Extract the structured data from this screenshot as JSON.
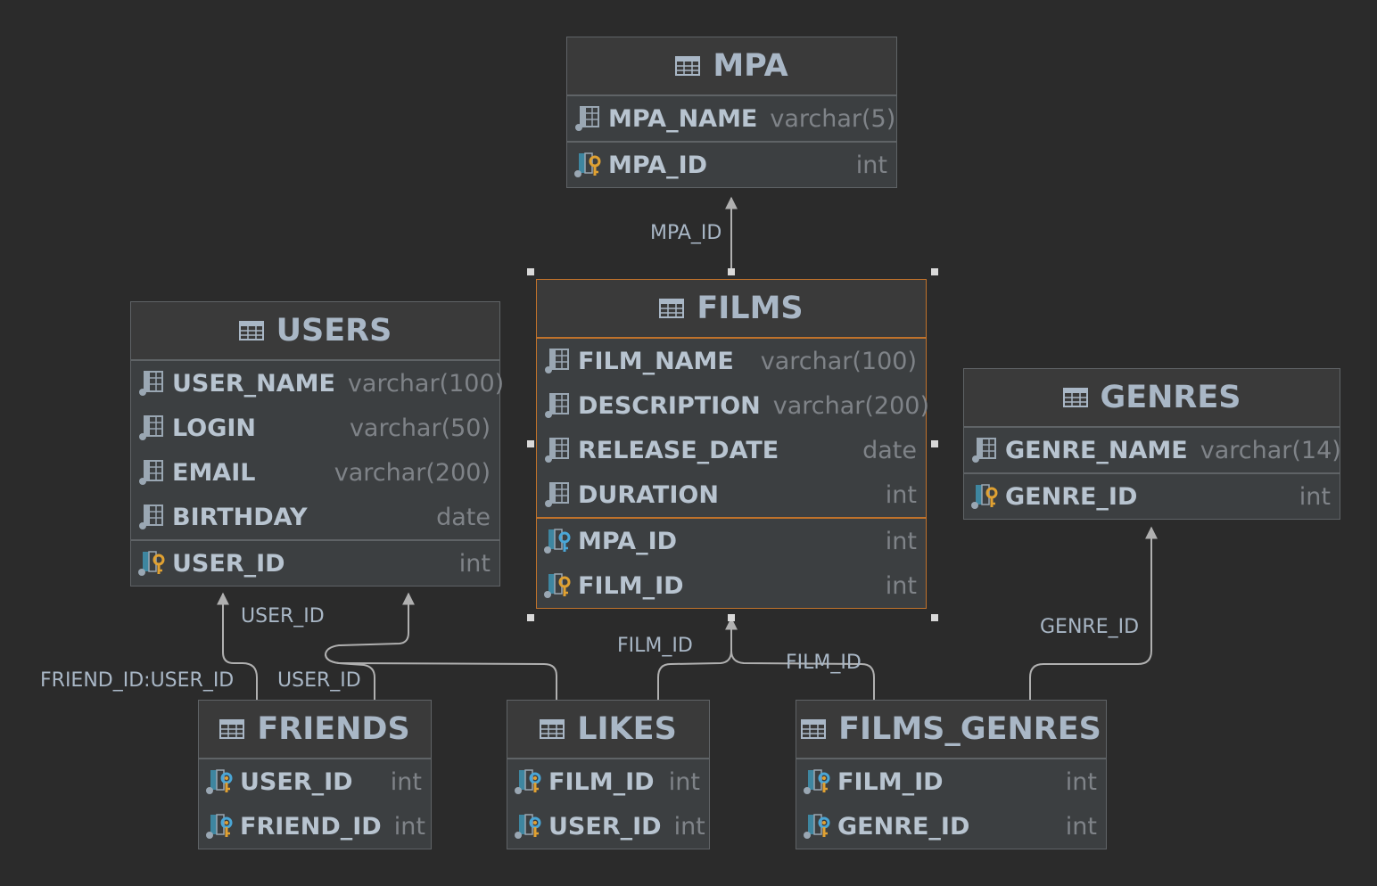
{
  "colors": {
    "background": "#2b2b2b",
    "table_bg": "#3c3f41",
    "selected_border": "#c0722b",
    "edge": "#b0b0b0",
    "text": "#a9b7c6",
    "type_text": "#7f8388"
  },
  "tables": {
    "mpa": {
      "name": "MPA",
      "columns": [
        {
          "name": "MPA_NAME",
          "type": "varchar(5)",
          "icon": "column-icon"
        },
        {
          "name": "MPA_ID",
          "type": "int",
          "icon": "primary-key-icon"
        }
      ]
    },
    "films": {
      "name": "FILMS",
      "selected": true,
      "columns": [
        {
          "name": "FILM_NAME",
          "type": "varchar(100)",
          "icon": "column-icon"
        },
        {
          "name": "DESCRIPTION",
          "type": "varchar(200)",
          "icon": "column-icon"
        },
        {
          "name": "RELEASE_DATE",
          "type": "date",
          "icon": "column-icon"
        },
        {
          "name": "DURATION",
          "type": "int",
          "icon": "column-icon"
        },
        {
          "name": "MPA_ID",
          "type": "int",
          "icon": "foreign-key-icon"
        },
        {
          "name": "FILM_ID",
          "type": "int",
          "icon": "primary-key-icon"
        }
      ]
    },
    "users": {
      "name": "USERS",
      "columns": [
        {
          "name": "USER_NAME",
          "type": "varchar(100)",
          "icon": "column-icon"
        },
        {
          "name": "LOGIN",
          "type": "varchar(50)",
          "icon": "column-icon"
        },
        {
          "name": "EMAIL",
          "type": "varchar(200)",
          "icon": "column-icon"
        },
        {
          "name": "BIRTHDAY",
          "type": "date",
          "icon": "column-icon"
        },
        {
          "name": "USER_ID",
          "type": "int",
          "icon": "primary-key-icon"
        }
      ]
    },
    "genres": {
      "name": "GENRES",
      "columns": [
        {
          "name": "GENRE_NAME",
          "type": "varchar(14)",
          "icon": "column-icon"
        },
        {
          "name": "GENRE_ID",
          "type": "int",
          "icon": "primary-key-icon"
        }
      ]
    },
    "friends": {
      "name": "FRIENDS",
      "columns": [
        {
          "name": "USER_ID",
          "type": "int",
          "icon": "primary-foreign-key-icon"
        },
        {
          "name": "FRIEND_ID",
          "type": "int",
          "icon": "primary-foreign-key-icon"
        }
      ]
    },
    "likes": {
      "name": "LIKES",
      "columns": [
        {
          "name": "FILM_ID",
          "type": "int",
          "icon": "primary-foreign-key-icon"
        },
        {
          "name": "USER_ID",
          "type": "int",
          "icon": "primary-foreign-key-icon"
        }
      ]
    },
    "films_genres": {
      "name": "FILMS_GENRES",
      "columns": [
        {
          "name": "FILM_ID",
          "type": "int",
          "icon": "primary-foreign-key-icon"
        },
        {
          "name": "GENRE_ID",
          "type": "int",
          "icon": "primary-foreign-key-icon"
        }
      ]
    }
  },
  "relations": {
    "films_mpa": "MPA_ID",
    "friends_user": "USER_ID",
    "friends_friend": "FRIEND_ID:USER_ID",
    "likes_user": "USER_ID",
    "likes_film": "FILM_ID",
    "films_genres_film": "FILM_ID",
    "films_genres_genre": "GENRE_ID"
  }
}
